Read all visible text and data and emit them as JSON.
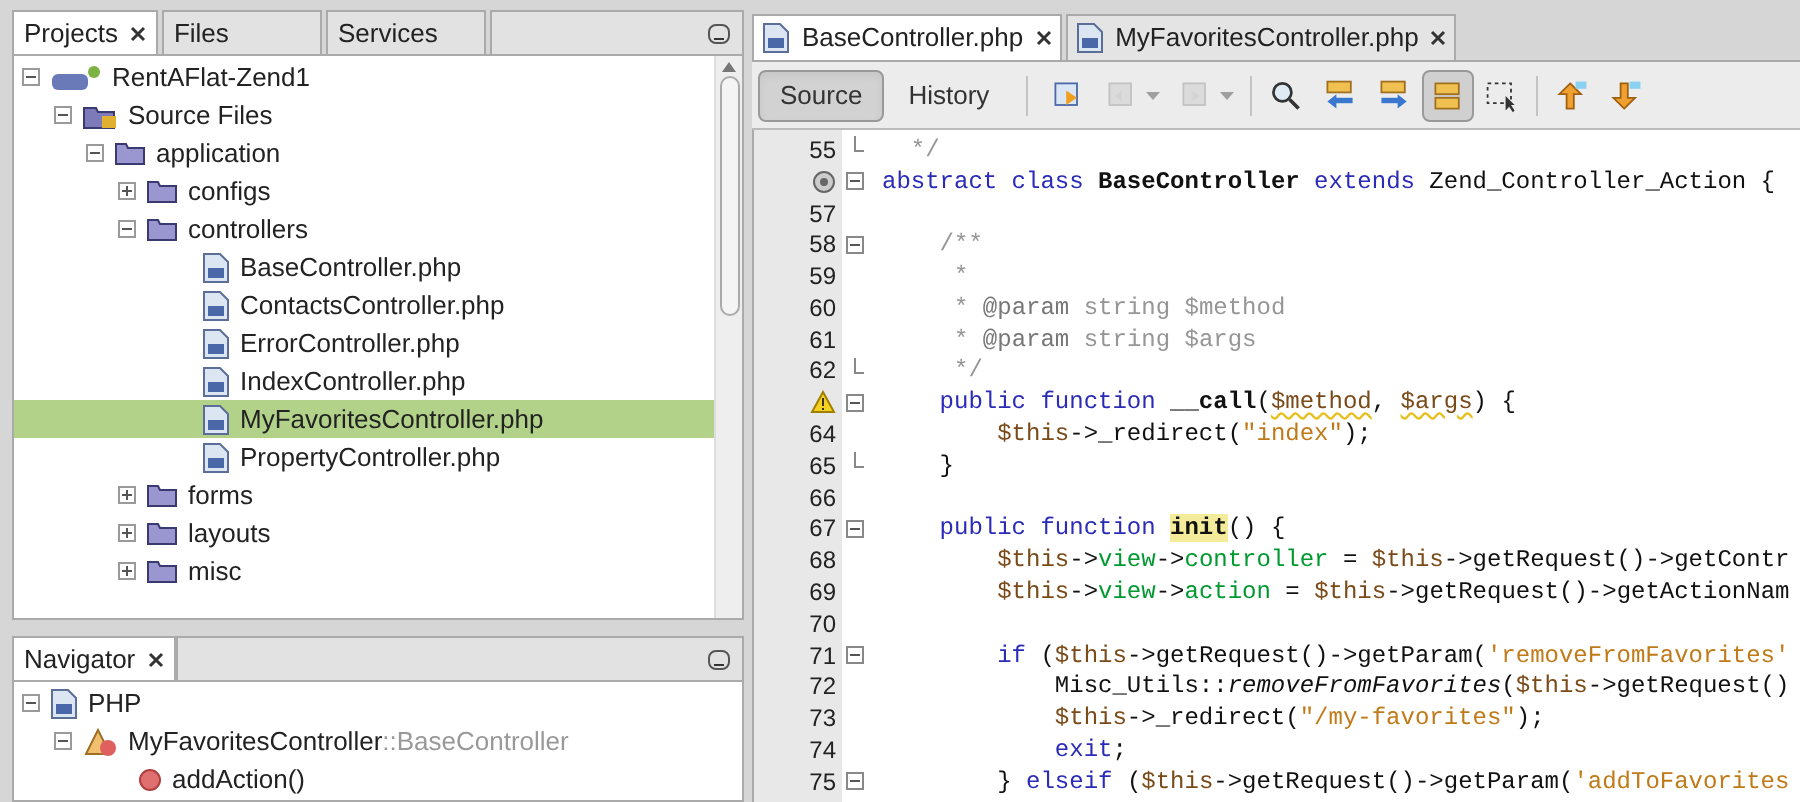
{
  "projects_panel": {
    "tabs": [
      {
        "label": "Projects",
        "selected": true,
        "closable": true
      },
      {
        "label": "Files",
        "selected": false,
        "closable": false
      },
      {
        "label": "Services",
        "selected": false,
        "closable": false
      }
    ],
    "tree": [
      {
        "label": "RentAFlat-Zend1",
        "kind": "project",
        "expanded": true,
        "selected": false,
        "children": [
          {
            "label": "Source Files",
            "kind": "source",
            "expanded": true,
            "selected": false,
            "children": [
              {
                "label": "application",
                "kind": "folder",
                "expanded": true,
                "selected": false,
                "children": [
                  {
                    "label": "configs",
                    "kind": "folder",
                    "expanded": false,
                    "selected": false
                  },
                  {
                    "label": "controllers",
                    "kind": "folder",
                    "expanded": true,
                    "selected": false,
                    "children": [
                      {
                        "label": "BaseController.php",
                        "kind": "file",
                        "selected": false
                      },
                      {
                        "label": "ContactsController.php",
                        "kind": "file",
                        "selected": false
                      },
                      {
                        "label": "ErrorController.php",
                        "kind": "file",
                        "selected": false
                      },
                      {
                        "label": "IndexController.php",
                        "kind": "file",
                        "selected": false
                      },
                      {
                        "label": "MyFavoritesController.php",
                        "kind": "file",
                        "selected": true
                      },
                      {
                        "label": "PropertyController.php",
                        "kind": "file",
                        "selected": false
                      }
                    ]
                  },
                  {
                    "label": "forms",
                    "kind": "folder",
                    "expanded": false,
                    "selected": false
                  },
                  {
                    "label": "layouts",
                    "kind": "folder",
                    "expanded": false,
                    "selected": false
                  },
                  {
                    "label": "misc",
                    "kind": "folder",
                    "expanded": false,
                    "selected": false
                  }
                ]
              }
            ]
          }
        ]
      }
    ]
  },
  "navigator": {
    "title": "Navigator",
    "tree": [
      {
        "label": "PHP",
        "kind": "php",
        "expanded": true,
        "selected": false,
        "children": [
          {
            "label": "MyFavoritesController",
            "suffix": "::BaseController",
            "kind": "class",
            "expanded": true,
            "selected": false,
            "children": [
              {
                "label": "addAction()",
                "kind": "method",
                "selected": false
              }
            ]
          }
        ]
      }
    ]
  },
  "editor": {
    "tabs": [
      {
        "label": "BaseController.php",
        "selected": true
      },
      {
        "label": "MyFavoritesController.php",
        "selected": false
      }
    ],
    "views": [
      {
        "label": "Source",
        "selected": true
      },
      {
        "label": "History",
        "selected": false
      }
    ],
    "toolbar": [
      {
        "kind": "last-edit",
        "on": false,
        "disabled": false,
        "menu": false
      },
      {
        "kind": "back",
        "on": false,
        "disabled": true,
        "menu": true
      },
      {
        "kind": "forward",
        "on": false,
        "disabled": true,
        "menu": true
      },
      {
        "kind": "find",
        "on": false,
        "disabled": false,
        "menu": false
      },
      {
        "kind": "find-prev",
        "on": false,
        "disabled": false,
        "menu": false
      },
      {
        "kind": "find-next",
        "on": false,
        "disabled": false,
        "menu": false
      },
      {
        "kind": "highlight",
        "on": true,
        "disabled": false,
        "menu": false
      },
      {
        "kind": "selection",
        "on": false,
        "disabled": false,
        "menu": false
      },
      {
        "kind": "prev-bookmark",
        "on": false,
        "disabled": false,
        "menu": false
      },
      {
        "kind": "next-bookmark",
        "on": false,
        "disabled": false,
        "menu": false
      }
    ],
    "lines": [
      {
        "number": "55",
        "fold": {
          "kind": "end"
        },
        "tokens": [
          {
            "kind": "comment",
            "text": "  */"
          }
        ]
      },
      {
        "marker": {
          "kind": "override"
        },
        "fold": {
          "kind": "open"
        },
        "tokens": [
          {
            "kind": "keyword",
            "text": "abstract class "
          },
          {
            "kind": "bold",
            "text": "BaseController"
          },
          {
            "kind": "keyword",
            "text": " extends "
          },
          {
            "kind": "plain",
            "text": "Zend_Controller_Action {"
          }
        ]
      },
      {
        "number": "57"
      },
      {
        "number": "58",
        "fold": {
          "kind": "open"
        },
        "tokens": [
          {
            "kind": "comment",
            "text": "    /**"
          }
        ]
      },
      {
        "number": "59",
        "tokens": [
          {
            "kind": "comment",
            "text": "     *"
          }
        ]
      },
      {
        "number": "60",
        "tokens": [
          {
            "kind": "comment",
            "text": "     * "
          },
          {
            "kind": "tag",
            "text": "@param"
          },
          {
            "kind": "comment",
            "text": " string $method"
          }
        ]
      },
      {
        "number": "61",
        "tokens": [
          {
            "kind": "comment",
            "text": "     * "
          },
          {
            "kind": "tag",
            "text": "@param"
          },
          {
            "kind": "comment",
            "text": " string $args"
          }
        ]
      },
      {
        "number": "62",
        "fold": {
          "kind": "end"
        },
        "tokens": [
          {
            "kind": "comment",
            "text": "     */"
          }
        ]
      },
      {
        "marker": {
          "kind": "warning"
        },
        "fold": {
          "kind": "open"
        },
        "tokens": [
          {
            "kind": "keyword",
            "text": "    public function "
          },
          {
            "kind": "bold",
            "text": "__call"
          },
          {
            "kind": "plain",
            "text": "("
          },
          {
            "kind": "warnvar",
            "text": "$method"
          },
          {
            "kind": "plain",
            "text": ", "
          },
          {
            "kind": "warnvar",
            "text": "$args"
          },
          {
            "kind": "plain",
            "text": ") {"
          }
        ]
      },
      {
        "number": "64",
        "tokens": [
          {
            "kind": "var",
            "text": "        $this"
          },
          {
            "kind": "plain",
            "text": "->_redirect("
          },
          {
            "kind": "string",
            "text": "\"index\""
          },
          {
            "kind": "plain",
            "text": ");"
          }
        ]
      },
      {
        "number": "65",
        "fold": {
          "kind": "end"
        },
        "tokens": [
          {
            "kind": "plain",
            "text": "    }"
          }
        ]
      },
      {
        "number": "66"
      },
      {
        "number": "67",
        "fold": {
          "kind": "open"
        },
        "tokens": [
          {
            "kind": "keyword",
            "text": "    public function "
          },
          {
            "kind": "mark",
            "text": "init"
          },
          {
            "kind": "plain",
            "text": "() {"
          }
        ]
      },
      {
        "number": "68",
        "tokens": [
          {
            "kind": "var",
            "text": "        $this"
          },
          {
            "kind": "plain",
            "text": "->"
          },
          {
            "kind": "field",
            "text": "view"
          },
          {
            "kind": "plain",
            "text": "->"
          },
          {
            "kind": "field",
            "text": "controller"
          },
          {
            "kind": "plain",
            "text": " = "
          },
          {
            "kind": "var",
            "text": "$this"
          },
          {
            "kind": "plain",
            "text": "->getRequest()->getContr"
          }
        ]
      },
      {
        "number": "69",
        "tokens": [
          {
            "kind": "var",
            "text": "        $this"
          },
          {
            "kind": "plain",
            "text": "->"
          },
          {
            "kind": "field",
            "text": "view"
          },
          {
            "kind": "plain",
            "text": "->"
          },
          {
            "kind": "field",
            "text": "action"
          },
          {
            "kind": "plain",
            "text": " = "
          },
          {
            "kind": "var",
            "text": "$this"
          },
          {
            "kind": "plain",
            "text": "->getRequest()->getActionNam"
          }
        ]
      },
      {
        "number": "70"
      },
      {
        "number": "71",
        "fold": {
          "kind": "open"
        },
        "tokens": [
          {
            "kind": "keyword",
            "text": "        if "
          },
          {
            "kind": "plain",
            "text": "("
          },
          {
            "kind": "var",
            "text": "$this"
          },
          {
            "kind": "plain",
            "text": "->getRequest()->getParam("
          },
          {
            "kind": "string",
            "text": "'removeFromFavorites'"
          }
        ]
      },
      {
        "number": "72",
        "tokens": [
          {
            "kind": "plain",
            "text": "            Misc_Utils::"
          },
          {
            "kind": "italic",
            "text": "removeFromFavorites"
          },
          {
            "kind": "plain",
            "text": "("
          },
          {
            "kind": "var",
            "text": "$this"
          },
          {
            "kind": "plain",
            "text": "->getRequest()"
          }
        ]
      },
      {
        "number": "73",
        "tokens": [
          {
            "kind": "var",
            "text": "            $this"
          },
          {
            "kind": "plain",
            "text": "->_redirect("
          },
          {
            "kind": "string",
            "text": "\"/my-favorites\""
          },
          {
            "kind": "plain",
            "text": ");"
          }
        ]
      },
      {
        "number": "74",
        "tokens": [
          {
            "kind": "keyword",
            "text": "            exit"
          },
          {
            "kind": "plain",
            "text": ";"
          }
        ]
      },
      {
        "number": "75",
        "fold": {
          "kind": "open"
        },
        "tokens": [
          {
            "kind": "plain",
            "text": "        } "
          },
          {
            "kind": "keyword",
            "text": "elseif "
          },
          {
            "kind": "plain",
            "text": "("
          },
          {
            "kind": "var",
            "text": "$this"
          },
          {
            "kind": "plain",
            "text": "->getRequest()->getParam("
          },
          {
            "kind": "string",
            "text": "'addToFavorites"
          }
        ]
      }
    ]
  }
}
